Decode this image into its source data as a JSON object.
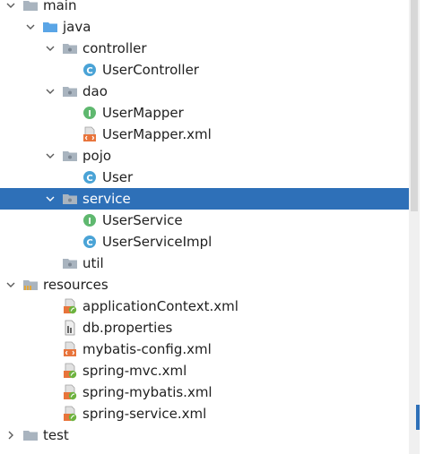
{
  "tree": {
    "nodes": [
      {
        "label": "main",
        "kind": "module-folder",
        "icon": "folder-icon",
        "expanded": true
      },
      {
        "label": "java",
        "kind": "source-folder",
        "icon": "source-folder-icon",
        "expanded": true
      },
      {
        "label": "controller",
        "kind": "package",
        "icon": "package-icon",
        "expanded": true
      },
      {
        "label": "UserController",
        "kind": "class",
        "icon": "class-icon"
      },
      {
        "label": "dao",
        "kind": "package",
        "icon": "package-icon",
        "expanded": true
      },
      {
        "label": "UserMapper",
        "kind": "interface",
        "icon": "interface-icon"
      },
      {
        "label": "UserMapper.xml",
        "kind": "xml",
        "icon": "xml-file-icon"
      },
      {
        "label": "pojo",
        "kind": "package",
        "icon": "package-icon",
        "expanded": true
      },
      {
        "label": "User",
        "kind": "class",
        "icon": "class-icon"
      },
      {
        "label": "service",
        "kind": "package",
        "icon": "package-icon",
        "expanded": true,
        "selected": true
      },
      {
        "label": "UserService",
        "kind": "interface",
        "icon": "interface-icon"
      },
      {
        "label": "UserServiceImpl",
        "kind": "class",
        "icon": "class-icon"
      },
      {
        "label": "util",
        "kind": "package",
        "icon": "package-icon",
        "expanded": false
      },
      {
        "label": "resources",
        "kind": "resources-folder",
        "icon": "resources-folder-icon",
        "expanded": true
      },
      {
        "label": "applicationContext.xml",
        "kind": "spring-xml",
        "icon": "spring-xml-icon"
      },
      {
        "label": "db.properties",
        "kind": "properties",
        "icon": "properties-file-icon"
      },
      {
        "label": "mybatis-config.xml",
        "kind": "xml",
        "icon": "xml-file-icon"
      },
      {
        "label": "spring-mvc.xml",
        "kind": "spring-xml",
        "icon": "spring-xml-icon"
      },
      {
        "label": "spring-mybatis.xml",
        "kind": "spring-xml",
        "icon": "spring-xml-icon"
      },
      {
        "label": "spring-service.xml",
        "kind": "spring-xml",
        "icon": "spring-xml-icon"
      },
      {
        "label": "test",
        "kind": "module-folder",
        "icon": "folder-icon",
        "expanded": false
      }
    ]
  },
  "colors": {
    "selection": "#2e70b8",
    "text": "#1f1f1f",
    "class_icon": "#4aa3d6",
    "interface_icon": "#5fb86f",
    "folder": "#a9b4bf",
    "source_folder": "#5aa5e6",
    "xml_orange": "#e8743b",
    "spring_green": "#6db33f"
  }
}
